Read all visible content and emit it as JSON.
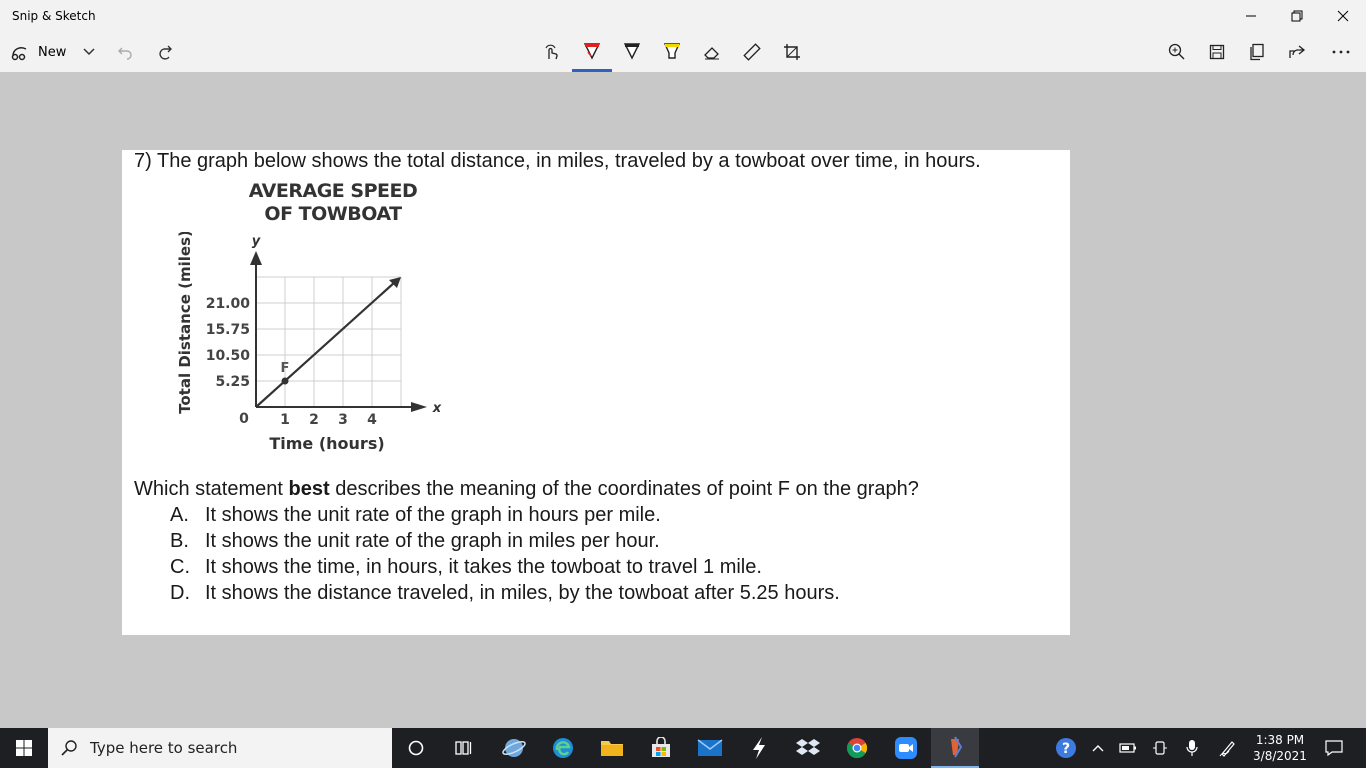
{
  "window": {
    "title": "Snip & Sketch"
  },
  "toolbar": {
    "new_label": "New"
  },
  "document": {
    "question_title": "7)  The graph below shows the total distance, in miles, traveled by a towboat over time, in hours.",
    "question_prefix": "Which statement ",
    "question_bold": "best",
    "question_suffix": " describes the meaning of the coordinates of point F on the graph?",
    "options": [
      {
        "letter": "A.",
        "text": "It shows the unit rate of the graph in hours per mile."
      },
      {
        "letter": "B.",
        "text": "It shows the unit rate of the graph in miles per hour."
      },
      {
        "letter": "C.",
        "text": "It shows the time, in hours, it takes the towboat to travel 1 mile."
      },
      {
        "letter": "D.",
        "text": "It shows the distance traveled, in miles, by the towboat after 5.25 hours."
      }
    ]
  },
  "chart_data": {
    "type": "line",
    "title_line1": "AVERAGE SPEED",
    "title_line2": "OF TOWBOAT",
    "xlabel": "Time (hours)",
    "ylabel": "Total Distance (miles)",
    "x_axis_letter": "x",
    "y_axis_letter": "y",
    "origin_label": "0",
    "x_ticks": [
      "1",
      "2",
      "3",
      "4"
    ],
    "y_ticks": [
      "5.25",
      "10.50",
      "15.75",
      "21.00"
    ],
    "xlim": [
      0,
      5
    ],
    "ylim": [
      0,
      26.25
    ],
    "grid": true,
    "series": [
      {
        "x": [
          0,
          1,
          5
        ],
        "y": [
          0,
          5.25,
          26.25
        ]
      }
    ],
    "point": {
      "label": "F",
      "x": 1,
      "y": 5.25
    }
  },
  "taskbar": {
    "search_placeholder": "Type here to search",
    "time": "1:38 PM",
    "date": "3/8/2021"
  }
}
